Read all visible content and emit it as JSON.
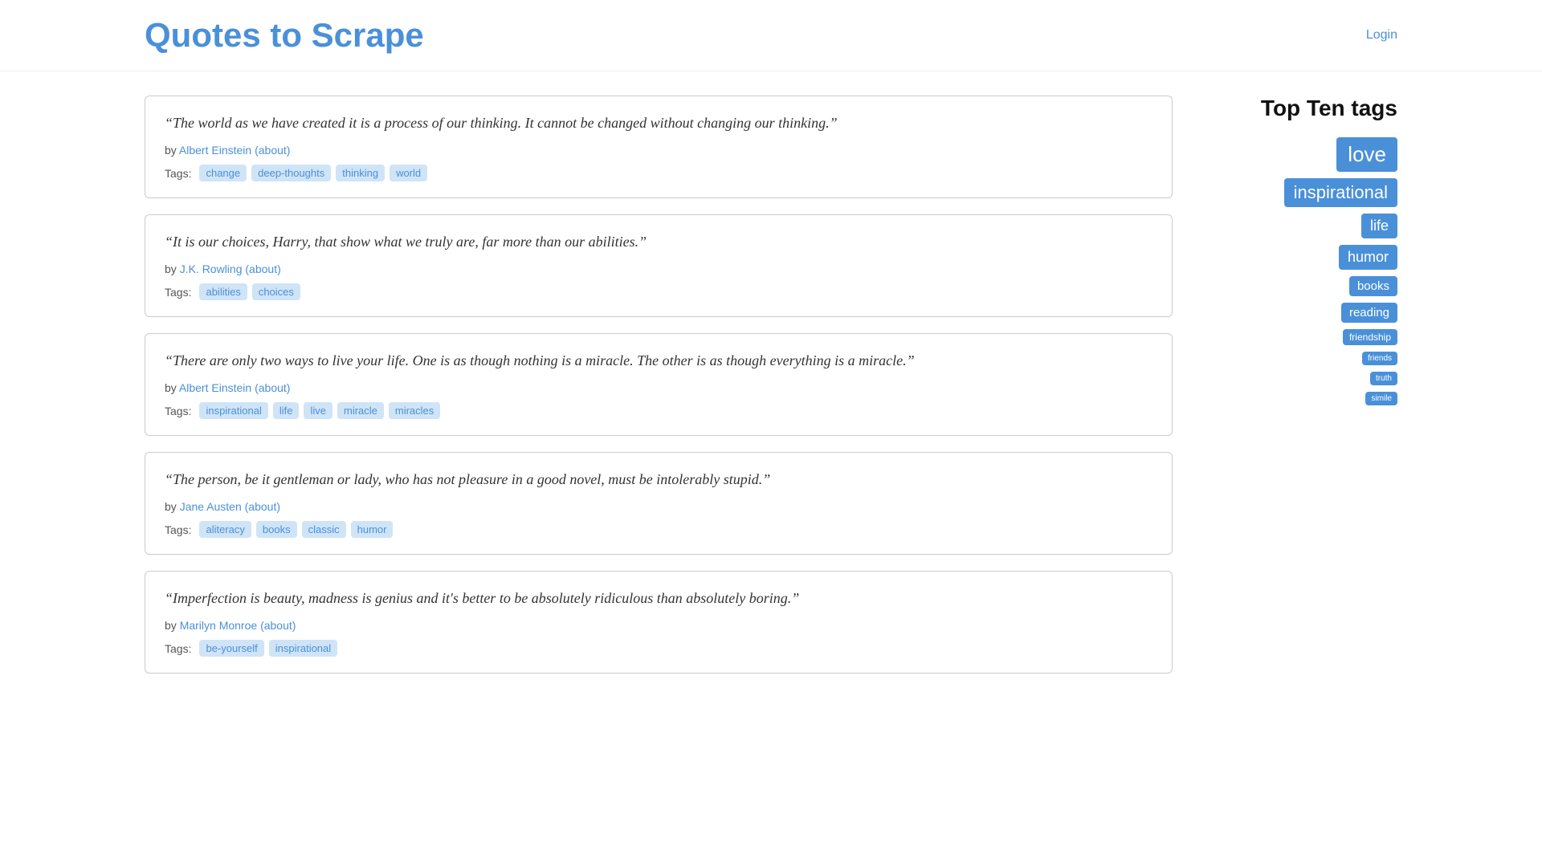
{
  "header": {
    "title": "Quotes to Scrape",
    "login_label": "Login"
  },
  "sidebar": {
    "title": "Top Ten tags",
    "tags": [
      {
        "label": "love",
        "size": "xl"
      },
      {
        "label": "inspirational",
        "size": "lg"
      },
      {
        "label": "life",
        "size": "md"
      },
      {
        "label": "humor",
        "size": "md"
      },
      {
        "label": "books",
        "size": "sm"
      },
      {
        "label": "reading",
        "size": "sm"
      },
      {
        "label": "friendship",
        "size": "xs"
      },
      {
        "label": "friends",
        "size": "xxs"
      },
      {
        "label": "truth",
        "size": "xxs"
      },
      {
        "label": "simile",
        "size": "xxs"
      }
    ]
  },
  "quotes": [
    {
      "text": "“The world as we have created it is a process of our thinking. It cannot be changed without changing our thinking.”",
      "author_name": "Albert Einstein",
      "author_link": "#",
      "about_link": "#",
      "tags": [
        "change",
        "deep-thoughts",
        "thinking",
        "world"
      ]
    },
    {
      "text": "“It is our choices, Harry, that show what we truly are, far more than our abilities.”",
      "author_name": "J.K. Rowling",
      "author_link": "#",
      "about_link": "#",
      "tags": [
        "abilities",
        "choices"
      ]
    },
    {
      "text": "“There are only two ways to live your life. One is as though nothing is a miracle. The other is as though everything is a miracle.”",
      "author_name": "Albert Einstein",
      "author_link": "#",
      "about_link": "#",
      "tags": [
        "inspirational",
        "life",
        "live",
        "miracle",
        "miracles"
      ]
    },
    {
      "text": "“The person, be it gentleman or lady, who has not pleasure in a good novel, must be intolerably stupid.”",
      "author_name": "Jane Austen",
      "author_link": "#",
      "about_link": "#",
      "tags": [
        "aliteracy",
        "books",
        "classic",
        "humor"
      ]
    },
    {
      "text": "“Imperfection is beauty, madness is genius and it's better to be absolutely ridiculous than absolutely boring.”",
      "author_name": "Marilyn Monroe",
      "author_link": "#",
      "about_link": "#",
      "tags": [
        "be-yourself",
        "inspirational"
      ]
    }
  ],
  "labels": {
    "by": "by",
    "about": "(about)",
    "tags_label": "Tags:"
  }
}
